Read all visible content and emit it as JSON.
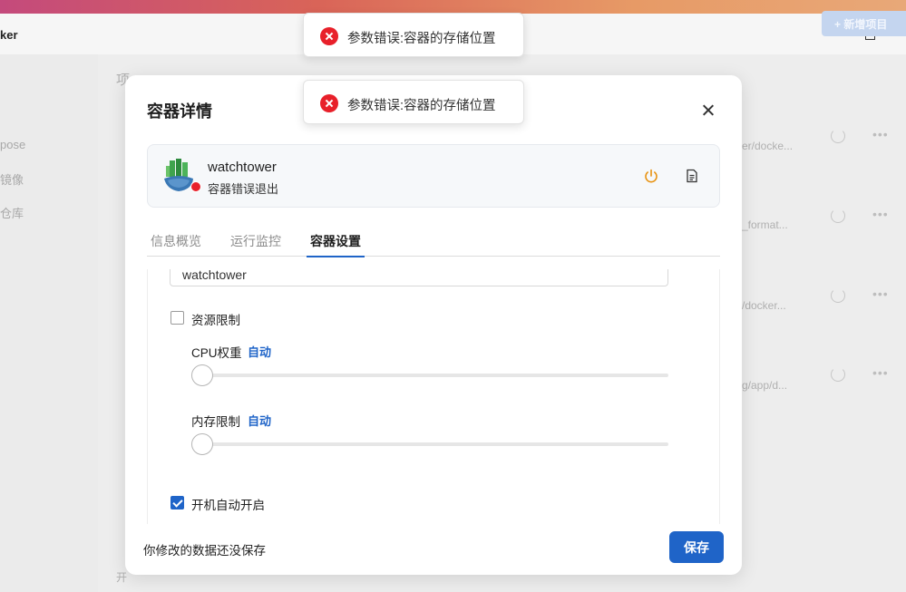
{
  "app": {
    "title": "ker"
  },
  "window_controls": {
    "minimize": "minimize-icon",
    "maximize": "maximize-icon"
  },
  "sidebar": {
    "items": [
      {
        "label": "pose"
      },
      {
        "label": "镜像"
      },
      {
        "label": "仓库"
      }
    ]
  },
  "background": {
    "header_fragment": "项",
    "add_button": "+ 新增项目",
    "rows": [
      {
        "path": "er/docke..."
      },
      {
        "path": "_format..."
      },
      {
        "path": "/docker..."
      },
      {
        "path": "g/app/d..."
      }
    ],
    "bottom_fragment": "开"
  },
  "toasts": [
    {
      "message": "参数错误:容器的存储位置",
      "icon": "error-icon"
    },
    {
      "message": "参数错误:容器的存储位置",
      "icon": "error-icon"
    }
  ],
  "dialog": {
    "title": "容器详情",
    "container": {
      "name": "watchtower",
      "status": "容器错误退出",
      "status_color": "#e8202a"
    },
    "tabs": [
      {
        "label": "信息概览",
        "active": false
      },
      {
        "label": "运行监控",
        "active": false
      },
      {
        "label": "容器设置",
        "active": true
      }
    ],
    "settings": {
      "name_value": "watchtower",
      "resource_limit": {
        "label": "资源限制",
        "checked": false
      },
      "cpu": {
        "label": "CPU权重",
        "value": "自动"
      },
      "memory": {
        "label": "内存限制",
        "value": "自动"
      },
      "autostart": {
        "label": "开机自动开启",
        "checked": true
      }
    },
    "footer": {
      "unsaved_notice": "你修改的数据还没保存",
      "save_label": "保存"
    }
  },
  "colors": {
    "accent": "#1f64c8",
    "error": "#e8202a",
    "warning": "#e8920f"
  }
}
